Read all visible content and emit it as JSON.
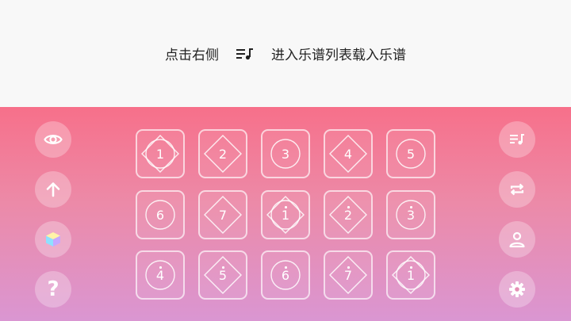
{
  "hint": {
    "before": "点击右侧",
    "icon": "music-list-icon",
    "after": "进入乐谱列表载入乐谱"
  },
  "left_buttons": [
    {
      "icon": "eye-icon"
    },
    {
      "icon": "arrow-up-icon"
    },
    {
      "icon": "cube-icon"
    },
    {
      "icon": "question-icon",
      "label": "?"
    }
  ],
  "right_buttons": [
    {
      "icon": "music-list-icon"
    },
    {
      "icon": "repeat-icon"
    },
    {
      "icon": "user-icon"
    },
    {
      "icon": "gear-icon"
    }
  ],
  "keys": [
    {
      "label": "1",
      "high": false,
      "shapes": [
        "circle",
        "diamond"
      ]
    },
    {
      "label": "2",
      "high": false,
      "shapes": [
        "diamond"
      ]
    },
    {
      "label": "3",
      "high": false,
      "shapes": [
        "circle"
      ]
    },
    {
      "label": "4",
      "high": false,
      "shapes": [
        "diamond"
      ]
    },
    {
      "label": "5",
      "high": false,
      "shapes": [
        "circle"
      ]
    },
    {
      "label": "6",
      "high": false,
      "shapes": [
        "circle"
      ]
    },
    {
      "label": "7",
      "high": false,
      "shapes": [
        "diamond"
      ]
    },
    {
      "label": "1",
      "high": true,
      "shapes": [
        "circle",
        "diamond"
      ]
    },
    {
      "label": "2",
      "high": true,
      "shapes": [
        "diamond"
      ]
    },
    {
      "label": "3",
      "high": true,
      "shapes": [
        "circle"
      ]
    },
    {
      "label": "4",
      "high": true,
      "shapes": [
        "circle"
      ]
    },
    {
      "label": "5",
      "high": true,
      "shapes": [
        "diamond"
      ]
    },
    {
      "label": "6",
      "high": true,
      "shapes": [
        "circle"
      ]
    },
    {
      "label": "7",
      "high": true,
      "shapes": [
        "diamond"
      ]
    },
    {
      "label": "1",
      "high": true,
      "shapes": [
        "circle",
        "diamond"
      ]
    }
  ]
}
